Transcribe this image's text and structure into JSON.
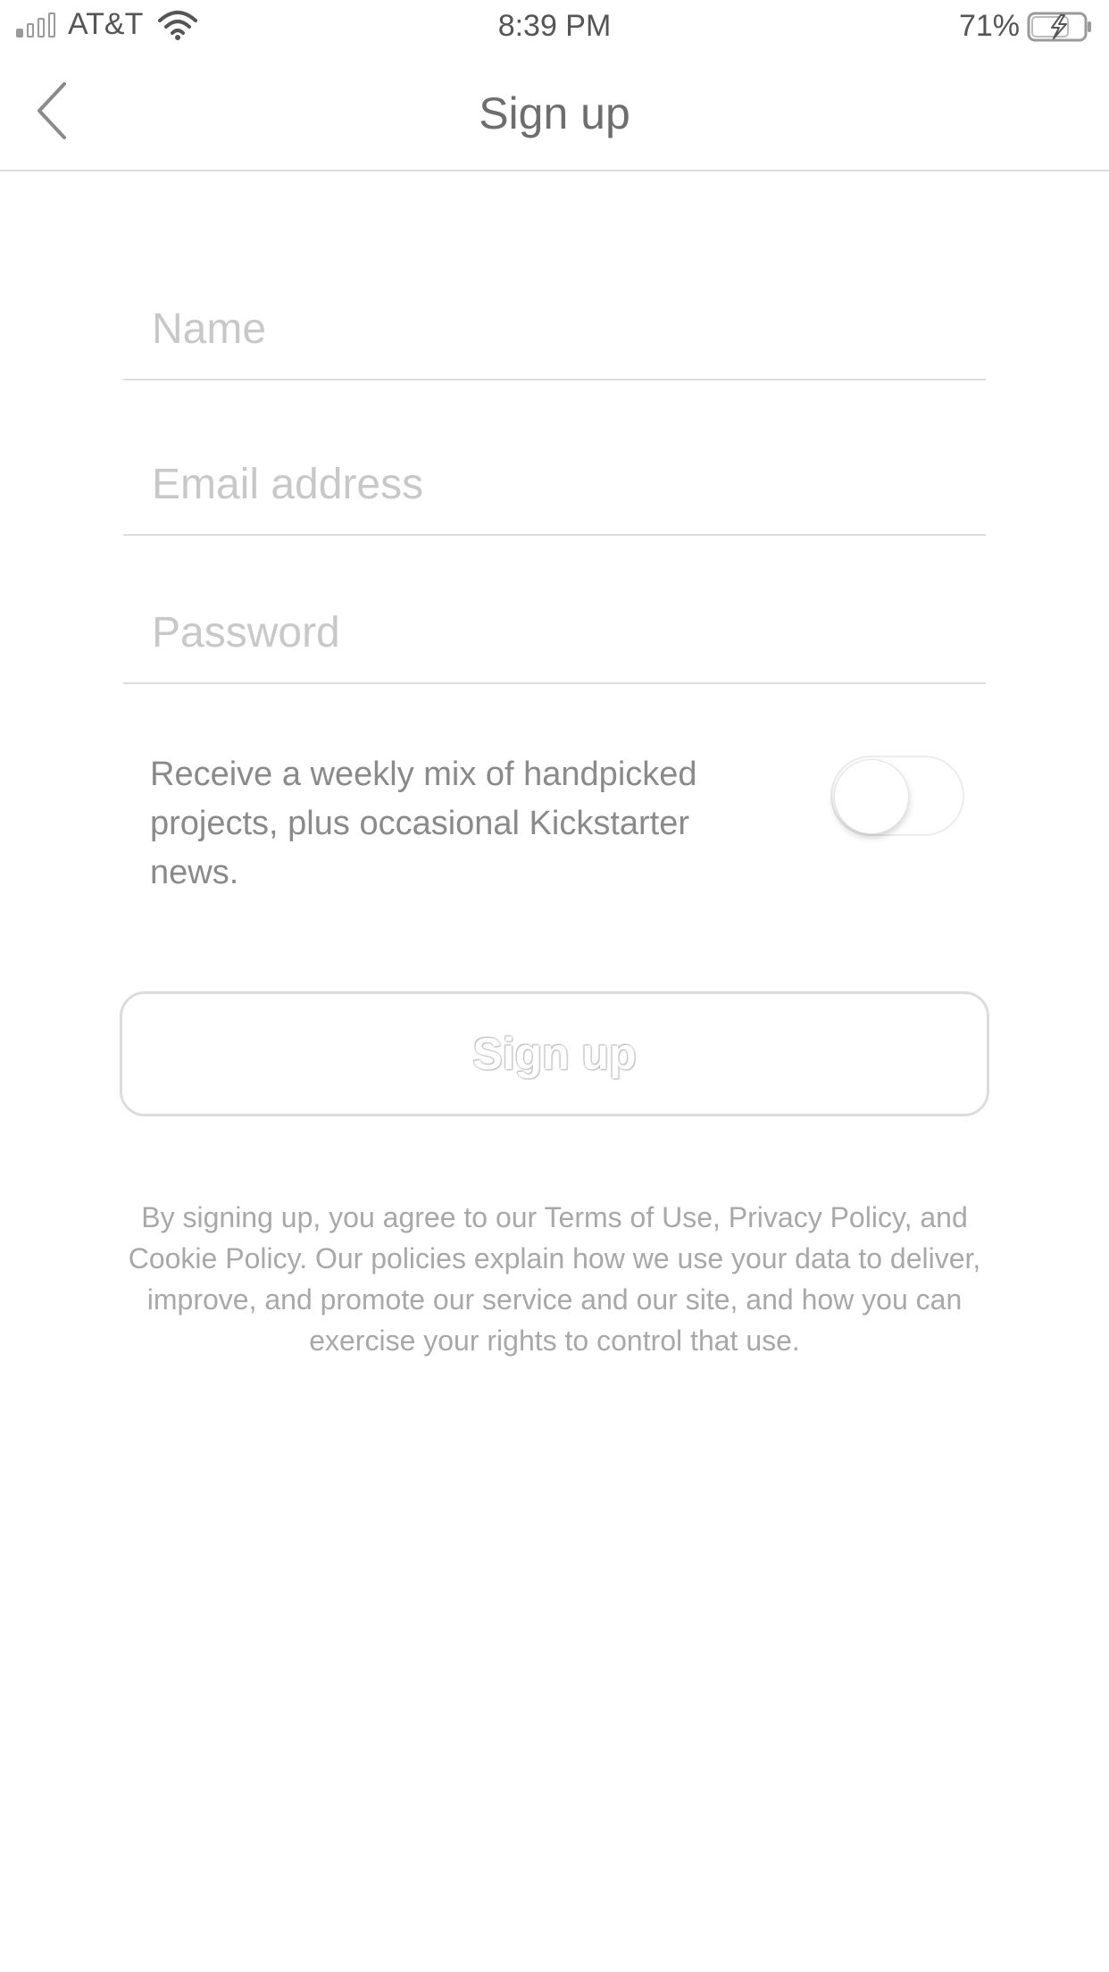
{
  "status_bar": {
    "carrier": "AT&T",
    "time": "8:39 PM",
    "battery_percent": "71%",
    "icons": [
      "signal-icon",
      "wifi-icon",
      "battery-charging-icon"
    ]
  },
  "nav": {
    "title": "Sign up",
    "back_icon": "chevron-left-icon"
  },
  "form": {
    "name": {
      "value": "",
      "placeholder": "Name"
    },
    "email": {
      "value": "",
      "placeholder": "Email address"
    },
    "password": {
      "value": "",
      "placeholder": "Password"
    }
  },
  "newsletter": {
    "text": "Receive a weekly mix of handpicked projects, plus occasional Kickstarter news.",
    "enabled": false
  },
  "signup_button": {
    "label": "Sign up"
  },
  "legal": {
    "text": "By signing up, you agree to our Terms of Use, Privacy Policy, and Cookie Policy. Our policies explain how we use your data to deliver, improve, and promote our service and our site, and how you can exercise your rights to control that use."
  },
  "colors": {
    "background": "#ffffff",
    "divider": "#dcdcdc",
    "placeholder": "#c8c8c8",
    "text_secondary": "#8a8a8a"
  }
}
